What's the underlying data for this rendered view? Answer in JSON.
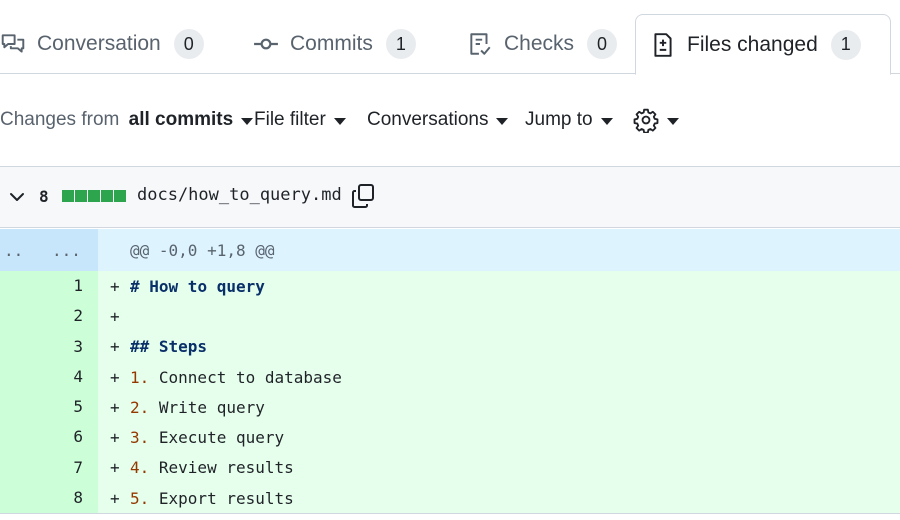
{
  "tabs": [
    {
      "label": "Conversation",
      "count": "0",
      "icon": "comment-discussion-icon"
    },
    {
      "label": "Commits",
      "count": "1",
      "icon": "git-commit-icon"
    },
    {
      "label": "Checks",
      "count": "0",
      "icon": "checklist-icon"
    },
    {
      "label": "Files changed",
      "count": "1",
      "icon": "file-diff-icon",
      "active": true
    }
  ],
  "toolbar": {
    "changes_prefix": "Changes from ",
    "changes_value": "all commits",
    "file_filter": "File filter",
    "conversations": "Conversations",
    "jump_to": "Jump to",
    "settings_icon": "gear-icon"
  },
  "file": {
    "changes": "8",
    "additions_blocks": 5,
    "path": "docs/how_to_query.md",
    "diffstat_color": "#2da44e"
  },
  "hunk": {
    "gutter_left": "..",
    "gutter_right": "...",
    "header": "@@ -0,0 +1,8 @@"
  },
  "lines": [
    {
      "num": "1",
      "sign": "+",
      "marker": "#",
      "text": " How to query"
    },
    {
      "num": "2",
      "sign": "+",
      "marker": "",
      "text": ""
    },
    {
      "num": "3",
      "sign": "+",
      "marker": "##",
      "text": " Steps"
    },
    {
      "num": "4",
      "sign": "+",
      "marker": "1.",
      "text": " Connect to database"
    },
    {
      "num": "5",
      "sign": "+",
      "marker": "2.",
      "text": " Write query"
    },
    {
      "num": "6",
      "sign": "+",
      "marker": "3.",
      "text": " Execute query"
    },
    {
      "num": "7",
      "sign": "+",
      "marker": "4.",
      "text": " Review results"
    },
    {
      "num": "8",
      "sign": "+",
      "marker": "5.",
      "text": " Export results"
    }
  ]
}
